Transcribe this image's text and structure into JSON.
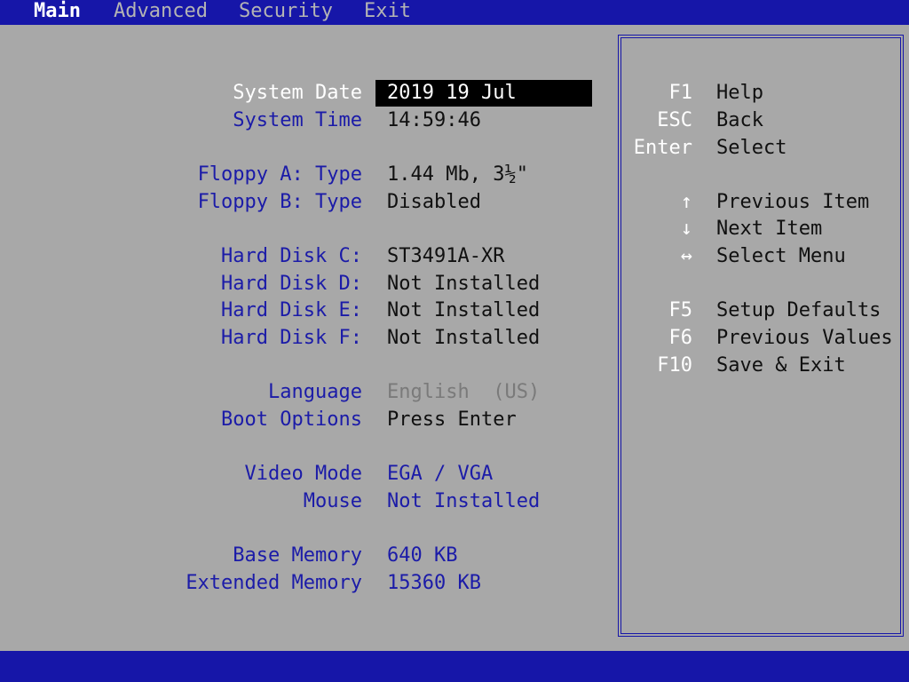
{
  "menu": {
    "items": [
      "Main",
      "Advanced",
      "Security",
      "Exit"
    ],
    "active": "Main"
  },
  "settings": {
    "system_date": {
      "label": "System Date",
      "value": "2019 19 Jul"
    },
    "system_time": {
      "label": "System Time",
      "value": "14:59:46"
    },
    "floppy_a": {
      "label": "Floppy A: Type",
      "value": "1.44 Mb, 3½\""
    },
    "floppy_b": {
      "label": "Floppy B: Type",
      "value": "Disabled"
    },
    "hdd_c": {
      "label": "Hard Disk C:",
      "value": "ST3491A-XR"
    },
    "hdd_d": {
      "label": "Hard Disk D:",
      "value": "Not Installed"
    },
    "hdd_e": {
      "label": "Hard Disk E:",
      "value": "Not Installed"
    },
    "hdd_f": {
      "label": "Hard Disk F:",
      "value": "Not Installed"
    },
    "language": {
      "label": "Language",
      "value": "English  (US)"
    },
    "boot_options": {
      "label": "Boot Options",
      "value": "Press Enter"
    },
    "video_mode": {
      "label": "Video Mode",
      "value": "EGA / VGA"
    },
    "mouse": {
      "label": "Mouse",
      "value": "Not Installed"
    },
    "base_memory": {
      "label": "Base Memory",
      "value": "640 KB"
    },
    "extended_memory": {
      "label": "Extended Memory",
      "value": "15360 KB"
    }
  },
  "help": {
    "f1": {
      "key": "F1",
      "desc": "Help"
    },
    "esc": {
      "key": "ESC",
      "desc": "Back"
    },
    "enter": {
      "key": "Enter",
      "desc": "Select"
    },
    "up": {
      "key": "↑",
      "desc": "Previous Item"
    },
    "down": {
      "key": "↓",
      "desc": "Next Item"
    },
    "leftright": {
      "key": "↔",
      "desc": "Select Menu"
    },
    "f5": {
      "key": "F5",
      "desc": "Setup Defaults"
    },
    "f6": {
      "key": "F6",
      "desc": "Previous Values"
    },
    "f10": {
      "key": "F10",
      "desc": "Save & Exit"
    }
  },
  "colors": {
    "background": "#a8a8a8",
    "bar": "#1616a8",
    "label": "#1b1ba8",
    "value": "#101010",
    "highlight": "#000000"
  }
}
